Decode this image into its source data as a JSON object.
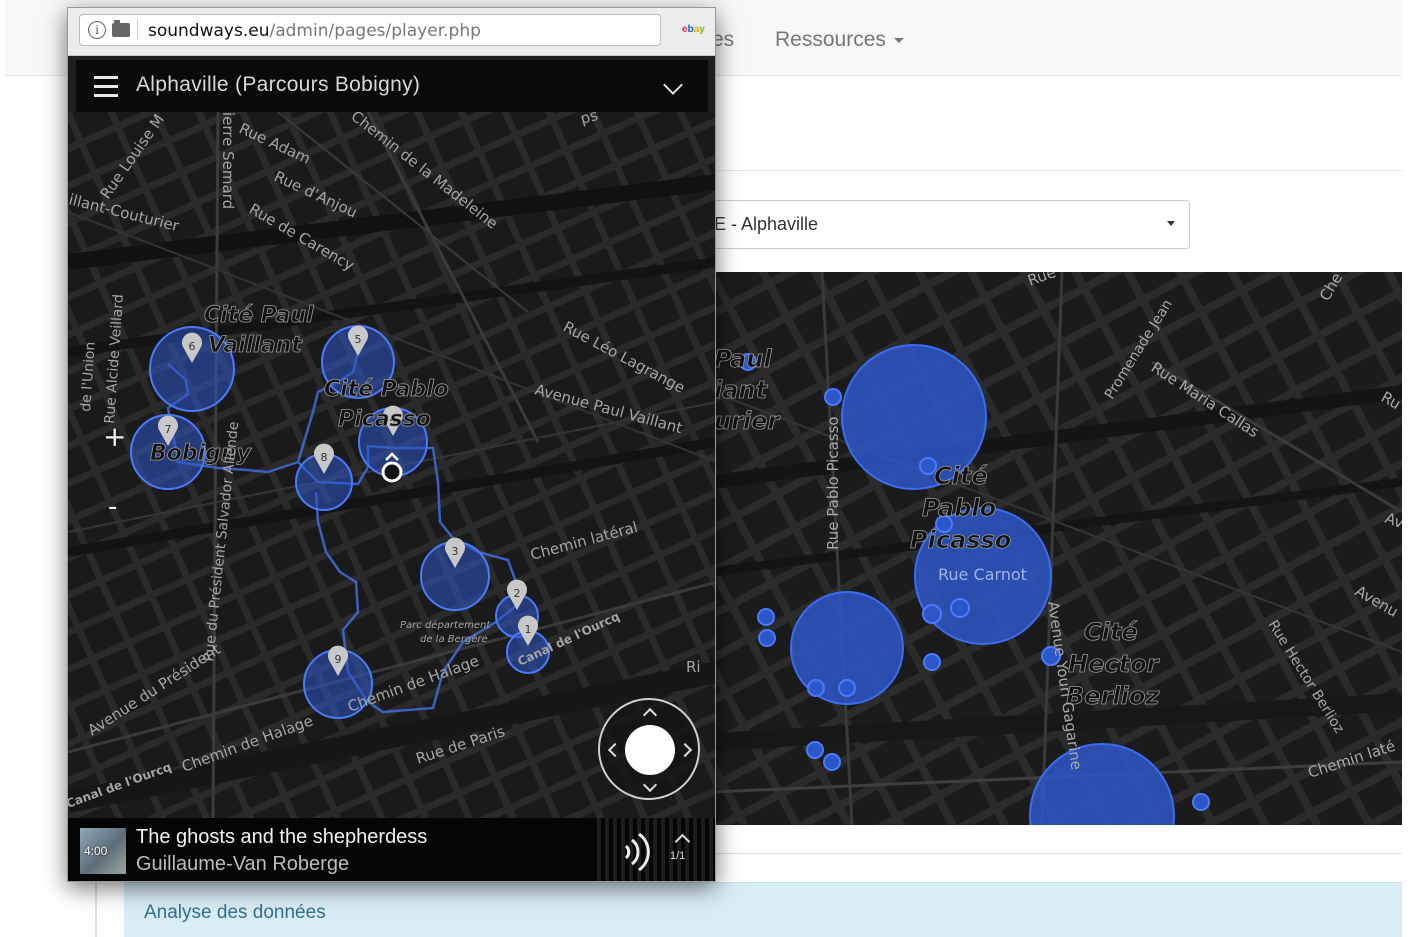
{
  "browser": {
    "url_domain": "soundways.eu",
    "url_path": "/admin/pages/player.php"
  },
  "background_page": {
    "nav": {
      "partial_item": "es",
      "resources": "Ressources"
    },
    "select_value": "E - Alphaville",
    "map_labels": {
      "paul": "Paul",
      "iant": "iant",
      "urier": "urier",
      "cite_pablo_1": "Cité",
      "cite_pablo_2": "Pablo",
      "cite_pablo_3": "Picasso",
      "rue_carnot": "Rue Carnot",
      "rue_pablo_picasso": "Rue Pablo Picasso",
      "cite_hector_1": "Cité",
      "cite_hector_2": "Hector",
      "cite_hector_3": "Berlioz",
      "avenue_youri_gagarine": "Avenue Youri Gagarine",
      "promenade_jean": "Promenade Jean",
      "rue_maria_callas": "Rue Maria Callas",
      "rue_hector_berlioz": "Rue Hector Berlioz",
      "chemin_lateral": "Chemin laté",
      "avenue_right": "Avenu",
      "rue_top": "Rue",
      "che_top": "Che",
      "ru_right": "Ru",
      "av_right": "Av"
    },
    "panel_title": "Analyse des données"
  },
  "player": {
    "title": "Alphaville (Parcours Bobigny)",
    "zoom_in": "+",
    "zoom_out": "-",
    "map_labels": {
      "rue_louise_m": "Rue Louise M",
      "pierre_semard": "ierre Semard",
      "rue_adam": "Rue Adam",
      "chemin_madeleine": "Chemin de la Madeleine",
      "rue_anjou": "Rue d'Anjou",
      "rue_carency": "Rue de Carency",
      "vaillant_couturier": "illant-Couturier",
      "cite_paul": "Cité Paul",
      "vaillant": "Vaillant",
      "cite_pablo": "Cité Pablo",
      "picasso": "Picasso",
      "bobigny": "Bobigny",
      "rue_leo_lagrange": "Rue Léo Lagrange",
      "avenue_paul_vaillant": "Avenue Paul Vaillant",
      "rue_alcide_veillard": "Rue Alcide Veillard",
      "de_lunion": "de l'Union",
      "rue_president_salvador_allende": "Rue du Président Salvador Allende",
      "chemin_lateral": "Chemin latéral",
      "parc_1": "Parc département",
      "parc_2": "de la Bergère",
      "canal_ourcq": "Canal de l'Ourcq",
      "avenue_du_president": "Avenue du Président",
      "chemin_halage": "Chemin de Halage",
      "chemin_halage_2": "Chemin de Halage",
      "rue_de_paris": "Rue de Paris",
      "canal_ourcq_2": "Canal de l'Ourcq",
      "rue_ps": "ps",
      "ri": "Ri"
    },
    "markers": [
      "1",
      "2",
      "3",
      "4",
      "5",
      "6",
      "7",
      "8",
      "9"
    ],
    "track": {
      "title": "The ghosts and the shepherdess",
      "artist": "Guillaume-Van Roberge",
      "duration": "4:00",
      "count": "1/1"
    }
  }
}
